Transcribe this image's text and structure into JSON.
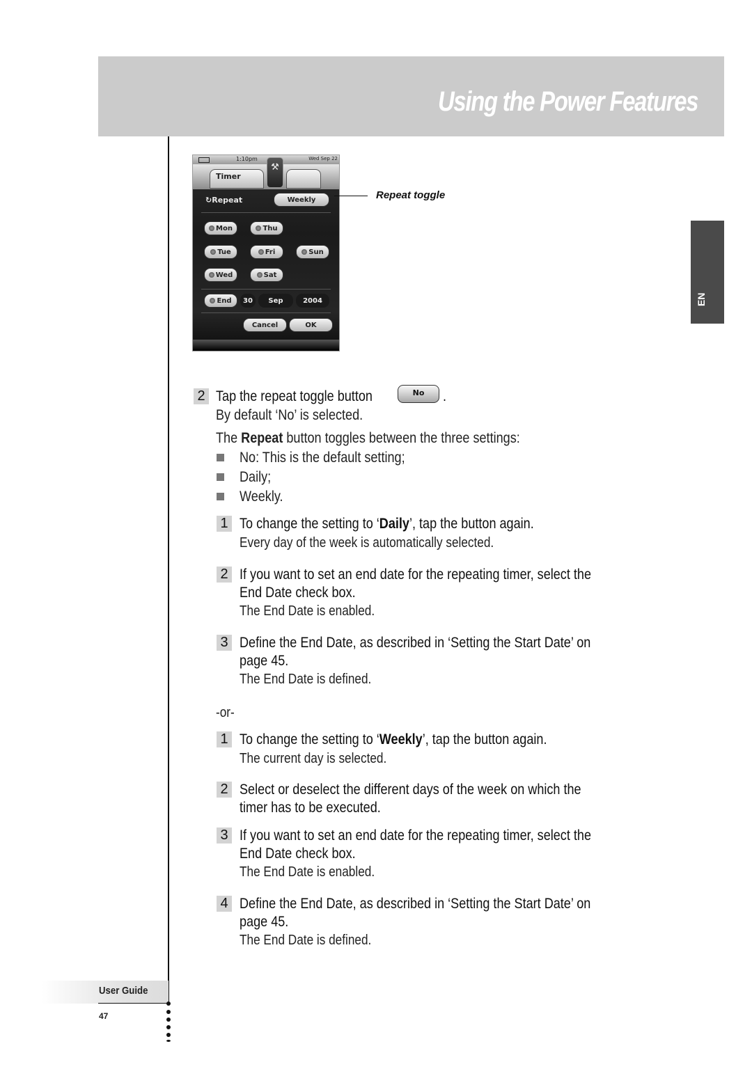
{
  "header": {
    "title": "Using the Power Features"
  },
  "language_tab": {
    "label": "EN"
  },
  "device_screen": {
    "status": {
      "time": "1:10pm",
      "date": "Wed Sep 22"
    },
    "tab_label": "Timer",
    "repeat_label": "Repeat",
    "repeat_value": "Weekly",
    "days": [
      "Mon",
      "Thu",
      "Tue",
      "Fri",
      "Sun",
      "Wed",
      "Sat"
    ],
    "end_label": "End",
    "end_date": {
      "day": "30",
      "month": "Sep",
      "year": "2004"
    },
    "cancel_label": "Cancel",
    "ok_label": "OK"
  },
  "callout": {
    "label": "Repeat toggle"
  },
  "intro_step": {
    "number": "2",
    "text": "Tap the repeat toggle button",
    "button_label": "No",
    "trailing": ".",
    "result": "By default ‘No’ is selected."
  },
  "toggle_intro": {
    "prefix": "The ",
    "bold": "Repeat",
    "suffix": " button toggles between the three settings:"
  },
  "settings": [
    "No: This is the default setting;",
    "Daily;",
    "Weekly."
  ],
  "daily_steps": [
    {
      "number": "1",
      "prefix": "To change the setting to ‘",
      "bold": "Daily",
      "suffix": "’, tap the button again.",
      "result": "Every day of the week is automatically selected."
    },
    {
      "number": "2",
      "line1": "If you want to set an end date for the repeating timer, select the",
      "line2": "End Date check box.",
      "result": "The End Date is enabled."
    },
    {
      "number": "3",
      "line1": "Define the End Date, as described in ‘Setting the Start Date’ on",
      "line2": "page 45.",
      "result": "The End Date is defined."
    }
  ],
  "or_separator": "-or-",
  "weekly_steps": [
    {
      "number": "1",
      "prefix": "To change the setting to ‘",
      "bold": "Weekly",
      "suffix": "’, tap the button again.",
      "result": "The current day is selected."
    },
    {
      "number": "2",
      "line1": "Select or deselect the different days of the week on which the",
      "line2": "timer has to be executed."
    },
    {
      "number": "3",
      "line1": "If you want to set an end date for the repeating timer, select the",
      "line2": "End Date check box.",
      "result": "The End Date is enabled."
    },
    {
      "number": "4",
      "line1": "Define the End Date, as described in ‘Setting the Start Date’ on",
      "line2": "page 45.",
      "result": "The End Date is defined."
    }
  ],
  "footer": {
    "label": "User Guide",
    "page_number": "47"
  }
}
